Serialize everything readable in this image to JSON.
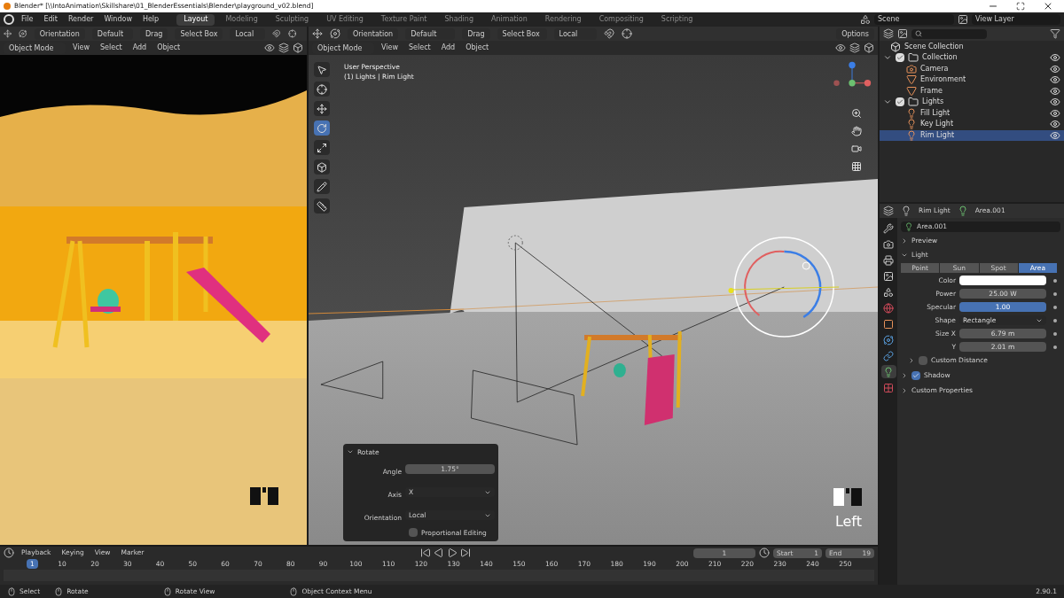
{
  "title_bar": {
    "title": "Blender* [\\\\IntoAnimation\\Skillshare\\01_BlenderEssentials\\Blender\\playground_v02.blend]"
  },
  "menu": [
    "File",
    "Edit",
    "Render",
    "Window",
    "Help"
  ],
  "workspaces": [
    {
      "label": "Layout",
      "selected": true
    },
    {
      "label": "Modeling",
      "selected": false
    },
    {
      "label": "Sculpting",
      "selected": false
    },
    {
      "label": "UV Editing",
      "selected": false
    },
    {
      "label": "Texture Paint",
      "selected": false
    },
    {
      "label": "Shading",
      "selected": false
    },
    {
      "label": "Animation",
      "selected": false
    },
    {
      "label": "Rendering",
      "selected": false
    },
    {
      "label": "Compositing",
      "selected": false
    },
    {
      "label": "Scripting",
      "selected": false
    }
  ],
  "scene": "Scene",
  "view_layer": "View Layer",
  "left_view": {
    "header": [
      "Orientation",
      "Default",
      "Drag",
      "Select Box",
      "Local"
    ],
    "menus": [
      "Object Mode",
      "View",
      "Select",
      "Add",
      "Object"
    ]
  },
  "main_view": {
    "header": [
      "Orientation",
      "Default",
      "Drag",
      "Select Box",
      "Local"
    ],
    "options": "Options",
    "menus": [
      "Object Mode",
      "View",
      "Select",
      "Add",
      "Object"
    ],
    "perspective": "User Perspective",
    "context": "(1) Lights | Rim Light",
    "view_label": "Left"
  },
  "rotate_panel": {
    "title": "Rotate",
    "fields": [
      {
        "label": "Angle",
        "value": "1.75°",
        "kind": "number"
      },
      {
        "label": "Axis",
        "value": "X",
        "kind": "dropdown"
      },
      {
        "label": "Orientation",
        "value": "Local",
        "kind": "dropdown"
      }
    ],
    "proportional": {
      "label": "Proportional Editing",
      "checked": false
    }
  },
  "outliner": {
    "root": "Scene Collection",
    "tree": [
      {
        "label": "Collection",
        "kind": "collection",
        "checked": true,
        "expanded": true,
        "selected": false,
        "children": [
          {
            "label": "Camera",
            "kind": "camera",
            "selected": false
          },
          {
            "label": "Environment",
            "kind": "mesh",
            "selected": false
          },
          {
            "label": "Frame",
            "kind": "mesh",
            "selected": false
          }
        ]
      },
      {
        "label": "Lights",
        "kind": "collection",
        "checked": true,
        "expanded": true,
        "selected": false,
        "children": [
          {
            "label": "Fill Light",
            "kind": "light",
            "selected": false
          },
          {
            "label": "Key Light",
            "kind": "light",
            "selected": false
          },
          {
            "label": "Rim Light",
            "kind": "light",
            "selected": true
          }
        ]
      }
    ]
  },
  "properties": {
    "object": "Rim Light",
    "data": "Area.001",
    "datablock": "Area.001",
    "tabs": [
      {
        "kind": "tool",
        "selected": false
      },
      {
        "kind": "render",
        "selected": false
      },
      {
        "kind": "output",
        "selected": false
      },
      {
        "kind": "view_layer",
        "selected": false
      },
      {
        "kind": "scene",
        "selected": false
      },
      {
        "kind": "world",
        "selected": false
      },
      {
        "kind": "object",
        "selected": false
      },
      {
        "kind": "physics",
        "selected": false
      },
      {
        "kind": "constraints",
        "selected": false
      },
      {
        "kind": "data",
        "selected": true
      },
      {
        "kind": "texture",
        "selected": false
      }
    ],
    "preview": {
      "label": "Preview",
      "expanded": false
    },
    "light": {
      "label": "Light",
      "expanded": true,
      "types": [
        {
          "label": "Point",
          "selected": false
        },
        {
          "label": "Sun",
          "selected": false
        },
        {
          "label": "Spot",
          "selected": false
        },
        {
          "label": "Area",
          "selected": true
        }
      ],
      "fields": [
        {
          "label": "Color",
          "kind": "color",
          "color": "#ffffff"
        },
        {
          "label": "Power",
          "kind": "number",
          "value": "25.00 W"
        },
        {
          "label": "Specular",
          "kind": "slider",
          "value": "1.00",
          "level": 1
        },
        {
          "label": "Shape",
          "kind": "dropdown",
          "value": "Rectangle"
        },
        {
          "label": "Size X",
          "kind": "number",
          "value": "6.79 m"
        },
        {
          "label": "Y",
          "kind": "number",
          "value": "2.01 m"
        }
      ],
      "children": [
        {
          "label": "Custom Distance",
          "kind": "checkbox",
          "checked": false
        }
      ]
    },
    "subpanels": [
      {
        "label": "Shadow",
        "kind": "checkbox",
        "checked": true
      },
      {
        "label": "Custom Properties",
        "kind": "plain"
      }
    ]
  },
  "timeline": {
    "menus": [
      "Playback",
      "Keying",
      "View",
      "Marker"
    ],
    "current_frame": "1",
    "start_label": "Start",
    "start": "1",
    "end_label": "End",
    "end": "19",
    "frame_marker": "1",
    "ticks": [
      "10",
      "20",
      "30",
      "40",
      "50",
      "60",
      "70",
      "80",
      "90",
      "100",
      "110",
      "120",
      "130",
      "140",
      "150",
      "160",
      "170",
      "180",
      "190",
      "200",
      "210",
      "220",
      "230",
      "240",
      "250"
    ]
  },
  "status_bar": {
    "items": [
      "Select",
      "Rotate",
      "Rotate View",
      "Object Context Menu"
    ],
    "version": "2.90.1"
  }
}
